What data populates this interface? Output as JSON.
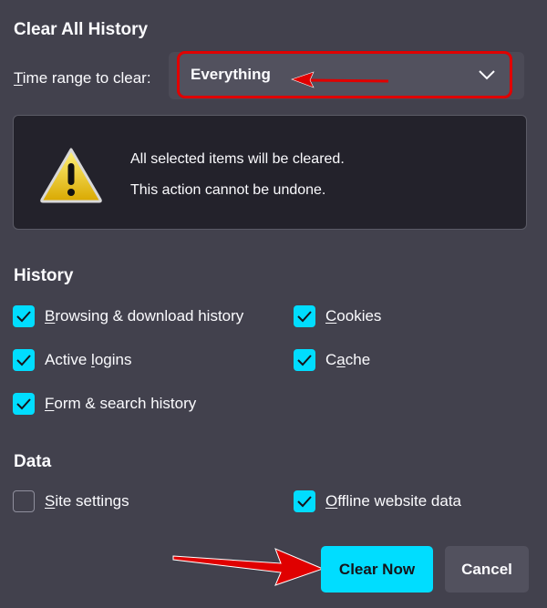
{
  "dialog": {
    "title": "Clear All History",
    "time_range": {
      "label_prefix": "T",
      "label_rest": "ime range to clear:",
      "selected": "Everything"
    },
    "warning": {
      "icon": "warning-triangle-icon",
      "line1": "All selected items will be cleared.",
      "line2": "This action cannot be undone."
    },
    "history_section": {
      "title": "History",
      "items": [
        {
          "pre": "",
          "key": "B",
          "post": "rowsing & download history",
          "checked": true
        },
        {
          "pre": "",
          "key": "C",
          "post": "ookies",
          "checked": true
        },
        {
          "pre": "Active ",
          "key": "l",
          "post": "ogins",
          "checked": true
        },
        {
          "pre": "C",
          "key": "a",
          "post": "che",
          "checked": true
        },
        {
          "pre": "",
          "key": "F",
          "post": "orm & search history",
          "checked": true
        }
      ]
    },
    "data_section": {
      "title": "Data",
      "items": [
        {
          "pre": "",
          "key": "S",
          "post": "ite settings",
          "checked": false
        },
        {
          "pre": "",
          "key": "O",
          "post": "ffline website data",
          "checked": true
        }
      ]
    },
    "buttons": {
      "clear_now": "Clear Now",
      "cancel": "Cancel"
    }
  },
  "colors": {
    "background": "#42414d",
    "accent": "#00ddff",
    "annotation": "#e00000"
  }
}
